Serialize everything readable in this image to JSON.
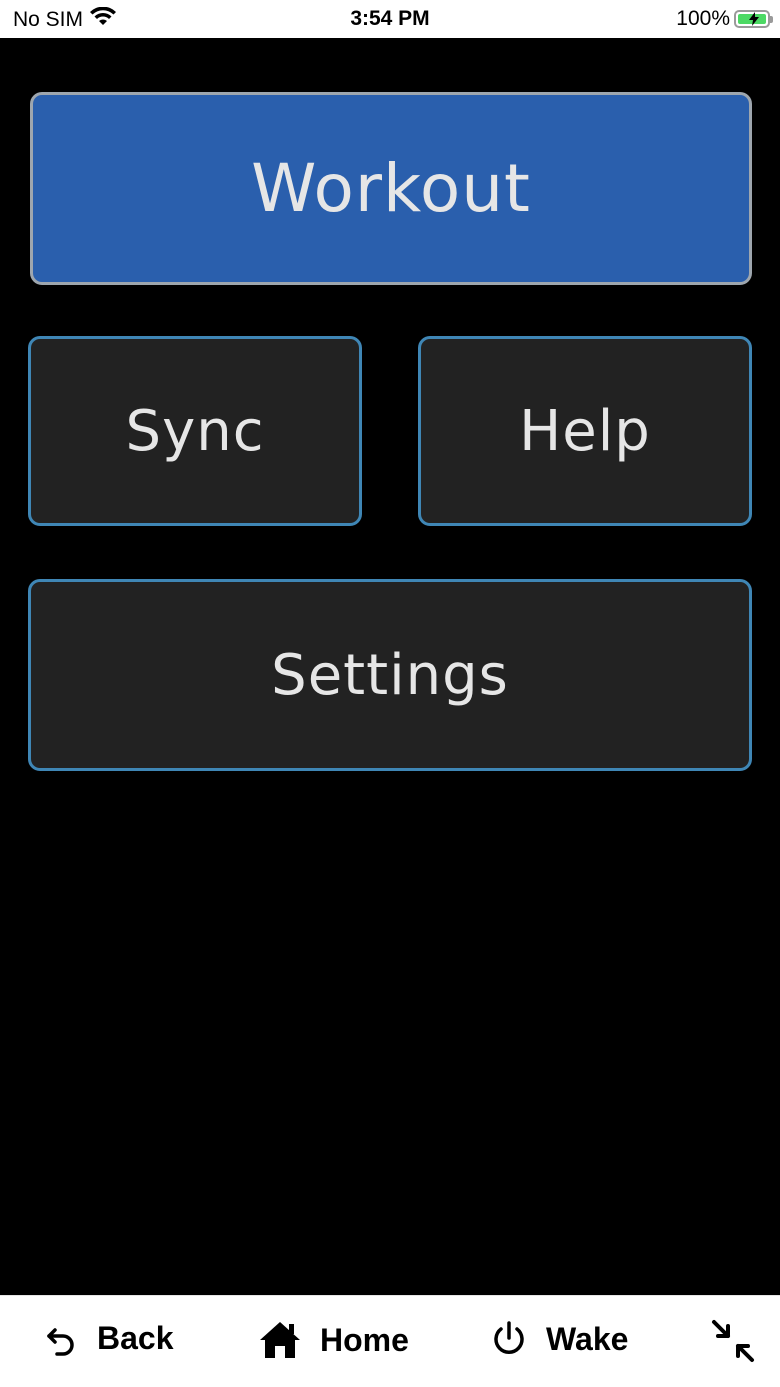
{
  "status_bar": {
    "carrier": "No SIM",
    "time": "3:54 PM",
    "battery_percent": "100%",
    "icons": [
      "wifi-icon",
      "battery-charging-icon"
    ]
  },
  "menu": {
    "workout_label": "Workout",
    "sync_label": "Sync",
    "help_label": "Help",
    "settings_label": "Settings"
  },
  "bottom_nav": {
    "back_label": "Back",
    "home_label": "Home",
    "wake_label": "Wake",
    "icons": [
      "back-arrow-icon",
      "home-icon",
      "power-icon",
      "collapse-icon"
    ]
  },
  "colors": {
    "primary_button": "#2a5fad",
    "secondary_button": "#222222",
    "secondary_border": "#3f86b5",
    "screen_background": "#000000",
    "battery_fill": "#4cd964"
  }
}
